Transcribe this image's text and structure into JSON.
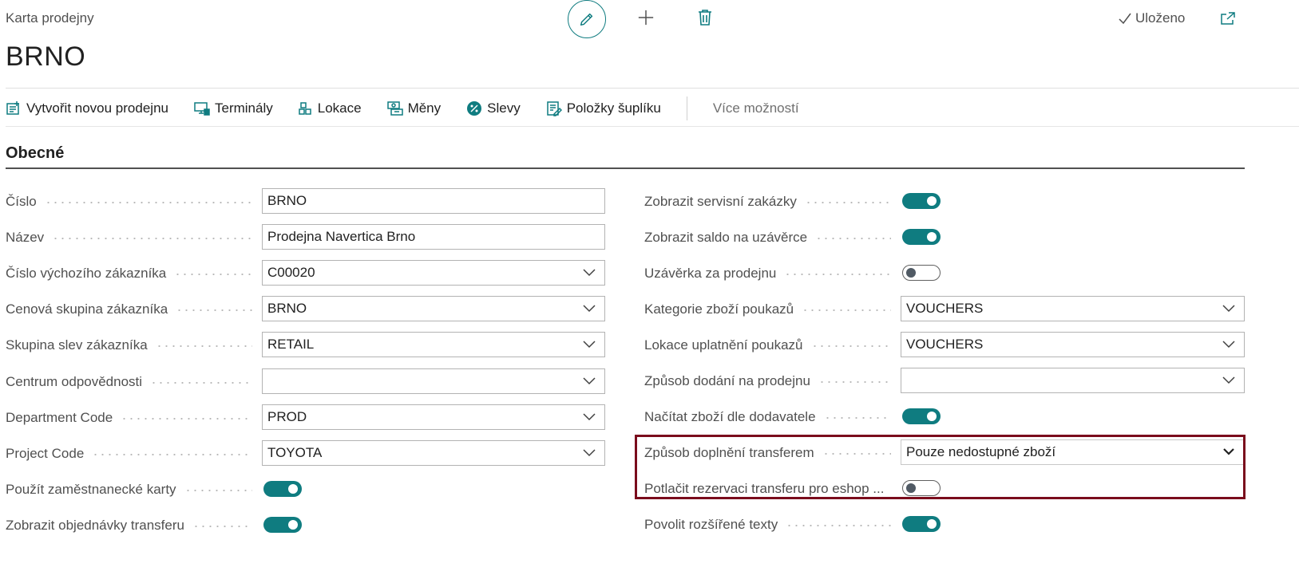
{
  "header": {
    "caption": "Karta prodejny",
    "title": "BRNO",
    "saved_label": "Uloženo"
  },
  "actions": [
    {
      "label": "Vytvořit novou prodejnu",
      "icon": "new-store-icon"
    },
    {
      "label": "Terminály",
      "icon": "terminal-icon"
    },
    {
      "label": "Lokace",
      "icon": "location-icon"
    },
    {
      "label": "Měny",
      "icon": "currency-icon"
    },
    {
      "label": "Slevy",
      "icon": "discount-icon"
    },
    {
      "label": "Položky šuplíku",
      "icon": "drawer-items-icon"
    }
  ],
  "more_label": "Více možností",
  "section_title": "Obecné",
  "left_fields": [
    {
      "label": "Číslo",
      "type": "text",
      "value": "BRNO"
    },
    {
      "label": "Název",
      "type": "text",
      "value": "Prodejna Navertica Brno"
    },
    {
      "label": "Číslo výchozího zákazníka",
      "type": "select",
      "value": "C00020"
    },
    {
      "label": "Cenová skupina zákazníka",
      "type": "select",
      "value": "BRNO"
    },
    {
      "label": "Skupina slev zákazníka",
      "type": "select",
      "value": "RETAIL"
    },
    {
      "label": "Centrum odpovědnosti",
      "type": "select",
      "value": ""
    },
    {
      "label": "Department Code",
      "type": "select",
      "value": "PROD"
    },
    {
      "label": "Project Code",
      "type": "select",
      "value": "TOYOTA"
    },
    {
      "label": "Použít zaměstnanecké karty",
      "type": "toggle",
      "on": true
    },
    {
      "label": "Zobrazit objednávky transferu",
      "type": "toggle",
      "on": true
    }
  ],
  "right_fields": [
    {
      "label": "Zobrazit servisní zakázky",
      "type": "toggle",
      "on": true
    },
    {
      "label": "Zobrazit saldo na uzávěrce",
      "type": "toggle",
      "on": true
    },
    {
      "label": "Uzávěrka za prodejnu",
      "type": "toggle",
      "on": false
    },
    {
      "label": "Kategorie zboží poukazů",
      "type": "select",
      "value": "VOUCHERS"
    },
    {
      "label": "Lokace uplatnění poukazů",
      "type": "select",
      "value": "VOUCHERS"
    },
    {
      "label": "Způsob dodání na prodejnu",
      "type": "select",
      "value": ""
    },
    {
      "label": "Načítat zboží dle dodavatele",
      "type": "toggle",
      "on": true
    },
    {
      "label": "Způsob doplnění transferem",
      "type": "select",
      "value": "Pouze nedostupné zboží",
      "focused": true
    },
    {
      "label": "Potlačit rezervaci transferu pro eshop ...",
      "type": "toggle",
      "on": false
    },
    {
      "label": "Povolit rozšířené texty",
      "type": "toggle",
      "on": true
    }
  ],
  "colors": {
    "accent": "#0f7c80",
    "highlight_border": "#7a0c1c"
  }
}
